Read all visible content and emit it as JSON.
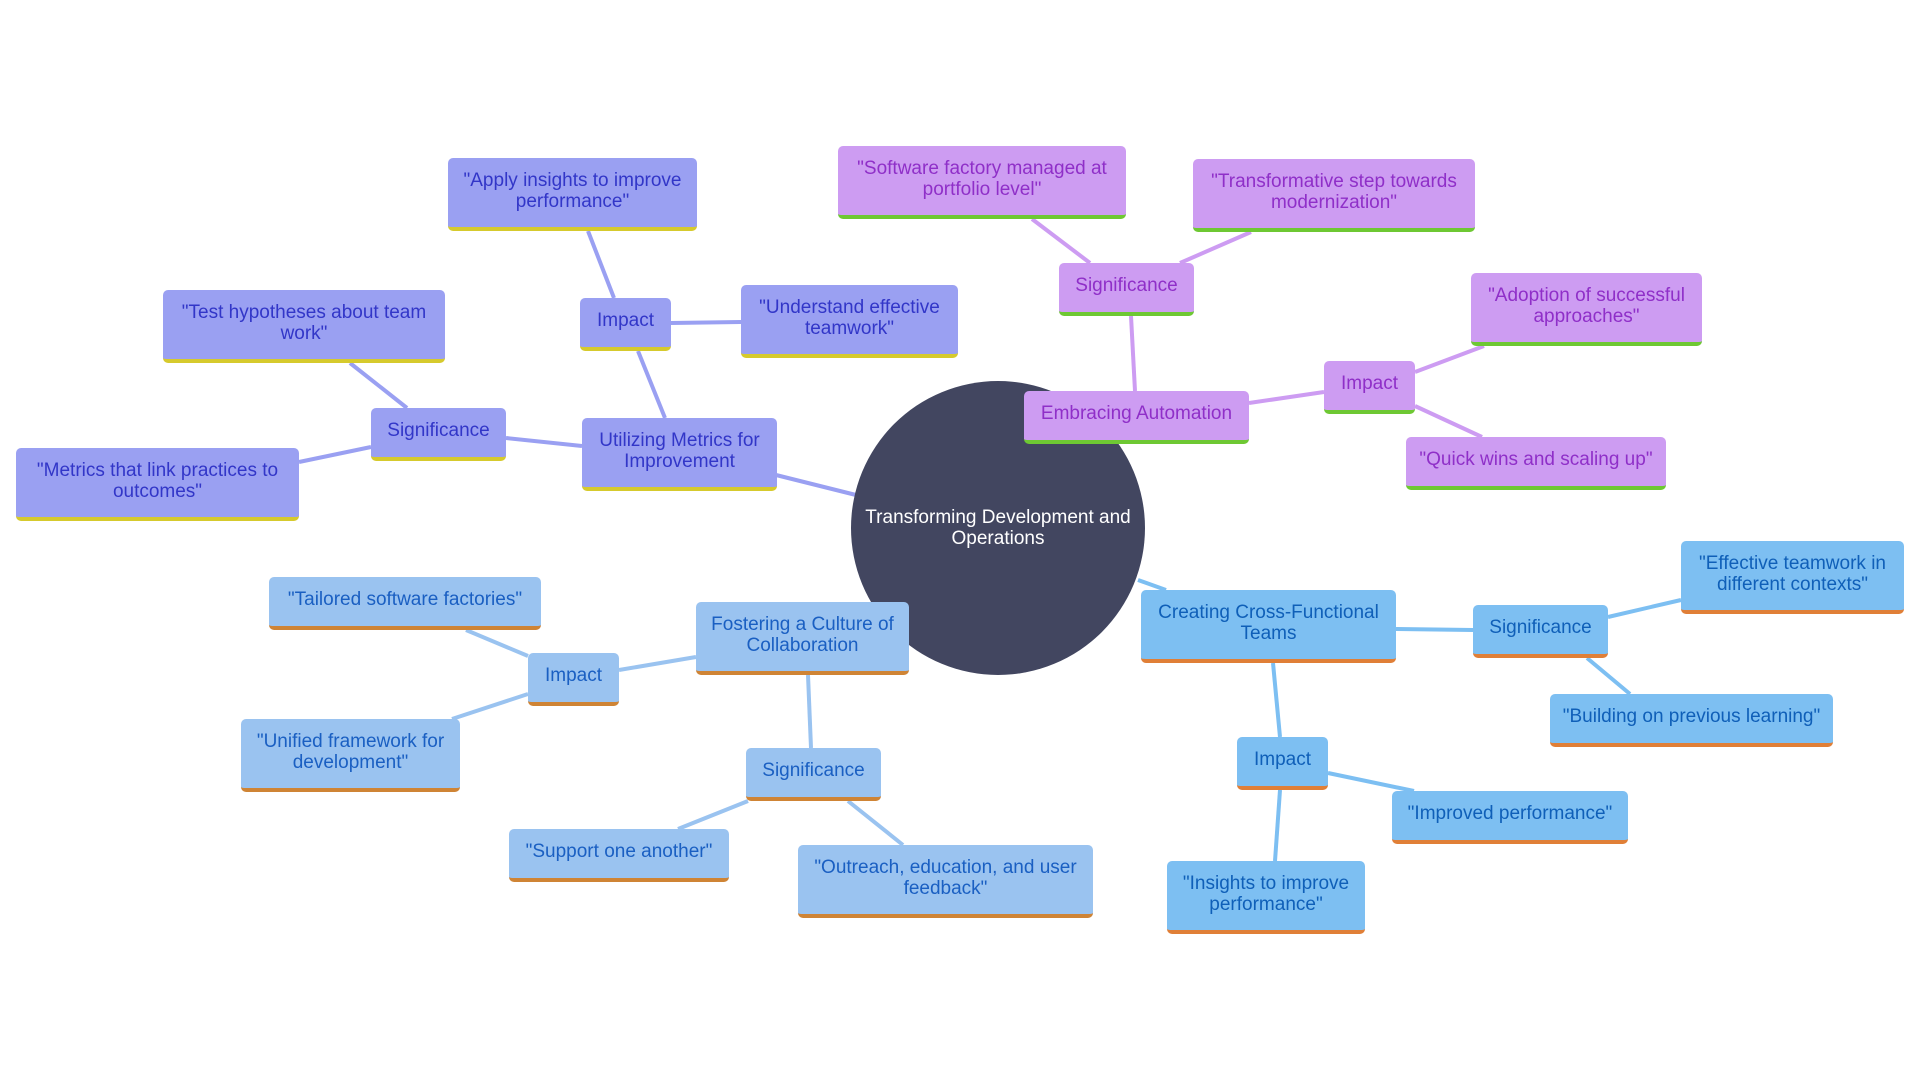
{
  "diagram": {
    "type": "mindmap",
    "root": "Transforming Development and Operations",
    "colors": {
      "root_fill": "#424660",
      "metrics": {
        "fill": "#9aa0f2",
        "text": "#3236c8",
        "underline": "#d6ca2d",
        "edge": "#9aa0f2"
      },
      "automation": {
        "fill": "#cd9cf2",
        "text": "#8f2fc8",
        "underline": "#6ec833",
        "edge": "#cd9cf2"
      },
      "cross_functional": {
        "fill": "#7dbff2",
        "text": "#0f5fb8",
        "underline": "#e07f37",
        "edge": "#7dbff2"
      },
      "collaboration": {
        "fill": "#9ac3f0",
        "text": "#1a5fc2",
        "underline": "#cf8435",
        "edge": "#9ac3f0"
      }
    },
    "branches": {
      "metrics": {
        "label": "Utilizing Metrics for Improvement",
        "impact": {
          "label": "Impact",
          "items": [
            "\"Apply insights to improve performance\"",
            "\"Understand effective teamwork\""
          ]
        },
        "significance": {
          "label": "Significance",
          "items": [
            "\"Test hypotheses about team work\"",
            "\"Metrics that link practices to outcomes\""
          ]
        }
      },
      "automation": {
        "label": "Embracing Automation",
        "significance": {
          "label": "Significance",
          "items": [
            "\"Software factory managed at portfolio level\"",
            "\"Transformative step towards modernization\""
          ]
        },
        "impact": {
          "label": "Impact",
          "items": [
            "\"Adoption of successful approaches\"",
            "\"Quick wins and scaling up\""
          ]
        }
      },
      "cross_functional": {
        "label": "Creating Cross-Functional Teams",
        "significance": {
          "label": "Significance",
          "items": [
            "\"Effective teamwork in different contexts\"",
            "\"Building on previous learning\""
          ]
        },
        "impact": {
          "label": "Impact",
          "items": [
            "\"Improved performance\"",
            "\"Insights to improve performance\""
          ]
        }
      },
      "collaboration": {
        "label": "Fostering a Culture of Collaboration",
        "impact": {
          "label": "Impact",
          "items": [
            "\"Tailored software factories\"",
            "\"Unified framework for development\""
          ]
        },
        "significance": {
          "label": "Significance",
          "items": [
            "\"Support one another\"",
            "\"Outreach, education, and user feedback\""
          ]
        }
      }
    }
  }
}
